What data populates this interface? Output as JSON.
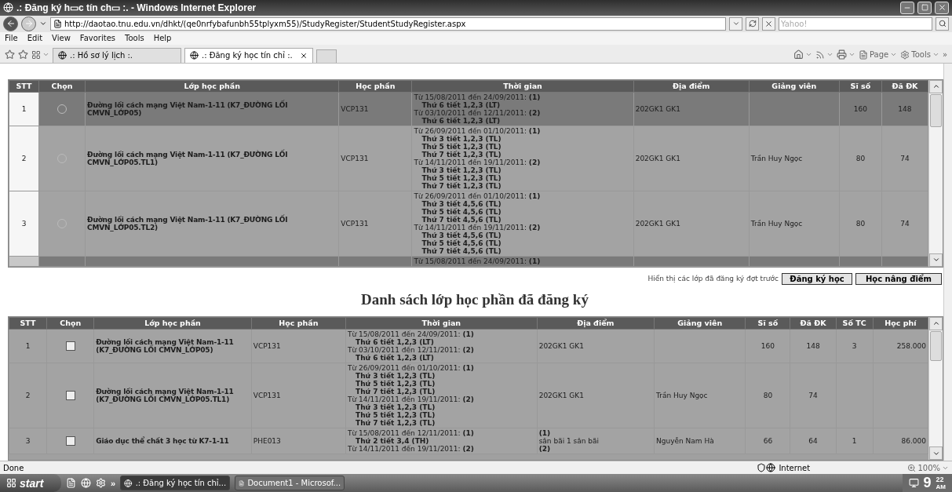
{
  "window": {
    "title": ".: Đăng ký h▭c tín ch▭ :. - Windows Internet Explorer"
  },
  "address_bar": {
    "url": "http://daotao.tnu.edu.vn/dhkt/(qe0nrfybafunbh55tplyxm55)/StudyRegister/StudentStudyRegister.aspx",
    "search_placeholder": "Yahoo!"
  },
  "menu": [
    "File",
    "Edit",
    "View",
    "Favorites",
    "Tools",
    "Help"
  ],
  "tabs": [
    {
      "label": ".: Hồ sơ lý lịch :.",
      "selected": false
    },
    {
      "label": ".: Đăng ký học tín chỉ :.",
      "selected": true
    }
  ],
  "command_bar": {
    "page": "Page",
    "tools": "Tools",
    "overflow": "»"
  },
  "course_table": {
    "columns": [
      "STT",
      "Chọn",
      "Lớp học phần",
      "Học phần",
      "Thời gian",
      "Địa điểm",
      "Giảng viên",
      "Sĩ số",
      "Đã ĐK"
    ],
    "rows": [
      {
        "stt": "1",
        "selected": false,
        "shaded": true,
        "name": "Đường lối cách mạng Việt Nam-1-11 (K7_ĐƯỜNG LỐI CMVN_LỚP05)",
        "code": "VCP131",
        "times": [
          {
            "kind": "period",
            "text": "Từ 15/08/2011 đến 24/09/2011: **(1)**"
          },
          {
            "kind": "session",
            "text": "Thứ 6 tiết 1,2,3 (LT)"
          },
          {
            "kind": "period",
            "text": "Từ 03/10/2011 đến 12/11/2011: **(2)**"
          },
          {
            "kind": "session",
            "text": "Thứ 6 tiết 1,2,3 (LT)"
          }
        ],
        "location": [
          "202GK1 GK1"
        ],
        "capacity": "160",
        "registered": "148"
      },
      {
        "stt": "2",
        "selected": false,
        "shaded": false,
        "name": "Đường lối cách mạng Việt Nam-1-11 (K7_ĐƯỜNG LỐI CMVN_LỚP05.TL1)",
        "code": "VCP131",
        "times": [
          {
            "kind": "period",
            "text": "Từ 26/09/2011 đến 01/10/2011: **(1)**"
          },
          {
            "kind": "session",
            "text": "Thứ 3 tiết 1,2,3 (TL)"
          },
          {
            "kind": "session",
            "text": "Thứ 5 tiết 1,2,3 (TL)"
          },
          {
            "kind": "session",
            "text": "Thứ 7 tiết 1,2,3 (TL)"
          },
          {
            "kind": "period",
            "text": "Từ 14/11/2011 đến 19/11/2011: **(2)**"
          },
          {
            "kind": "session",
            "text": "Thứ 3 tiết 1,2,3 (TL)"
          },
          {
            "kind": "session",
            "text": "Thứ 5 tiết 1,2,3 (TL)"
          },
          {
            "kind": "session",
            "text": "Thứ 7 tiết 1,2,3 (TL)"
          }
        ],
        "location": [
          "202GK1 GK1"
        ],
        "teacher": "Trần Huy Ngọc",
        "capacity": "80",
        "registered": "74"
      },
      {
        "stt": "3",
        "selected": false,
        "shaded": false,
        "name": "Đường lối cách mạng Việt Nam-1-11 (K7_ĐƯỜNG LỐI CMVN_LỚP05.TL2)",
        "code": "VCP131",
        "times": [
          {
            "kind": "period",
            "text": "Từ 26/09/2011 đến 01/10/2011: **(1)**"
          },
          {
            "kind": "session",
            "text": "Thứ 3 tiết 4,5,6 (TL)"
          },
          {
            "kind": "session",
            "text": "Thứ 5 tiết 4,5,6 (TL)"
          },
          {
            "kind": "session",
            "text": "Thứ 7 tiết 4,5,6 (TL)"
          },
          {
            "kind": "period",
            "text": "Từ 14/11/2011 đến 19/11/2011: **(2)**"
          },
          {
            "kind": "session",
            "text": "Thứ 3 tiết 4,5,6 (TL)"
          },
          {
            "kind": "session",
            "text": "Thứ 5 tiết 4,5,6 (TL)"
          },
          {
            "kind": "session",
            "text": "Thứ 7 tiết 4,5,6 (TL)"
          }
        ],
        "location": [
          "202GK1 GK1"
        ],
        "teacher": "Trần Huy Ngọc",
        "capacity": "80",
        "registered": "74"
      },
      {
        "shaded": true,
        "times": [
          {
            "kind": "period",
            "text": "Từ 15/08/2011 đến 24/09/2011: **(1)**"
          }
        ]
      }
    ]
  },
  "registered": {
    "hint": "Hiển thị các lớp đã đăng ký đợt trước",
    "buttons": [
      "Đăng ký học",
      "Học nâng điểm"
    ],
    "title": "Danh sách lớp học phần đã đăng ký",
    "columns": [
      "STT",
      "Chọn",
      "Lớp học phần",
      "Học phần",
      "Thời gian",
      "Địa điểm",
      "Giảng viên",
      "Sĩ số",
      "Đã ĐK",
      "Số TC",
      "Học phí"
    ],
    "rows": [
      {
        "stt": "1",
        "checked": false,
        "name": "Đường lối cách mạng Việt Nam-1-11 (K7_ĐƯỜNG LỐI CMVN_LỚP05)",
        "code": "VCP131",
        "times": [
          {
            "kind": "period",
            "text": "Từ 15/08/2011 đến 24/09/2011: **(1)**"
          },
          {
            "kind": "session",
            "text": "Thứ 6 tiết 1,2,3 (LT)"
          },
          {
            "kind": "period",
            "text": "Từ 03/10/2011 đến 12/11/2011: **(2)**"
          },
          {
            "kind": "session",
            "text": "Thứ 6 tiết 1,2,3 (LT)"
          }
        ],
        "location": [
          "202GK1 GK1"
        ],
        "capacity": "160",
        "registered": "148",
        "credits": "3",
        "fee": "258.000"
      },
      {
        "stt": "2",
        "checked": false,
        "name": "Đường lối cách mạng Việt Nam-1-11 (K7_ĐƯỜNG LỐI CMVN_LỚP05.TL1)",
        "code": "VCP131",
        "times": [
          {
            "kind": "period",
            "text": "Từ 26/09/2011 đến 01/10/2011: **(1)**"
          },
          {
            "kind": "session",
            "text": "Thứ 3 tiết 1,2,3 (TL)"
          },
          {
            "kind": "session",
            "text": "Thứ 5 tiết 1,2,3 (TL)"
          },
          {
            "kind": "session",
            "text": "Thứ 7 tiết 1,2,3 (TL)"
          },
          {
            "kind": "period",
            "text": "Từ 14/11/2011 đến 19/11/2011: **(2)**"
          },
          {
            "kind": "session",
            "text": "Thứ 3 tiết 1,2,3 (TL)"
          },
          {
            "kind": "session",
            "text": "Thứ 5 tiết 1,2,3 (TL)"
          },
          {
            "kind": "session",
            "text": "Thứ 7 tiết 1,2,3 (TL)"
          }
        ],
        "location": [
          "202GK1 GK1"
        ],
        "teacher": "Trần Huy Ngọc",
        "capacity": "80",
        "registered": "74"
      },
      {
        "stt": "3",
        "checked": false,
        "name": "Giáo dục thể chất 3 học từ K7-1-11",
        "code": "PHE013",
        "times": [
          {
            "kind": "period",
            "text": "Từ 15/08/2011 đến 12/11/2011: **(1)**"
          },
          {
            "kind": "session",
            "text": "Thứ 2 tiết 3,4 (TH)"
          },
          {
            "kind": "period",
            "text": "Từ 14/11/2011 đến 19/11/2011: **(2)**"
          }
        ],
        "location": [
          "**(1)**",
          "sân bãi 1 sân bãi",
          "**(2)**"
        ],
        "teacher": "Nguyễn Nam Hà",
        "capacity": "66",
        "registered": "64",
        "credits": "1",
        "fee": "86.000"
      }
    ]
  },
  "status_bar": {
    "text": "Done",
    "zone": "Internet",
    "zoom": "100%"
  },
  "taskbar": {
    "start": "start",
    "overflow": "»",
    "windows": [
      {
        "label": ".: Đăng ký học tín chỉ...",
        "selected": true
      },
      {
        "label": "Document1 - Microsof...",
        "selected": false
      }
    ],
    "clock": {
      "hour": "9",
      "minute": "22",
      "meridiem": "AM"
    }
  }
}
